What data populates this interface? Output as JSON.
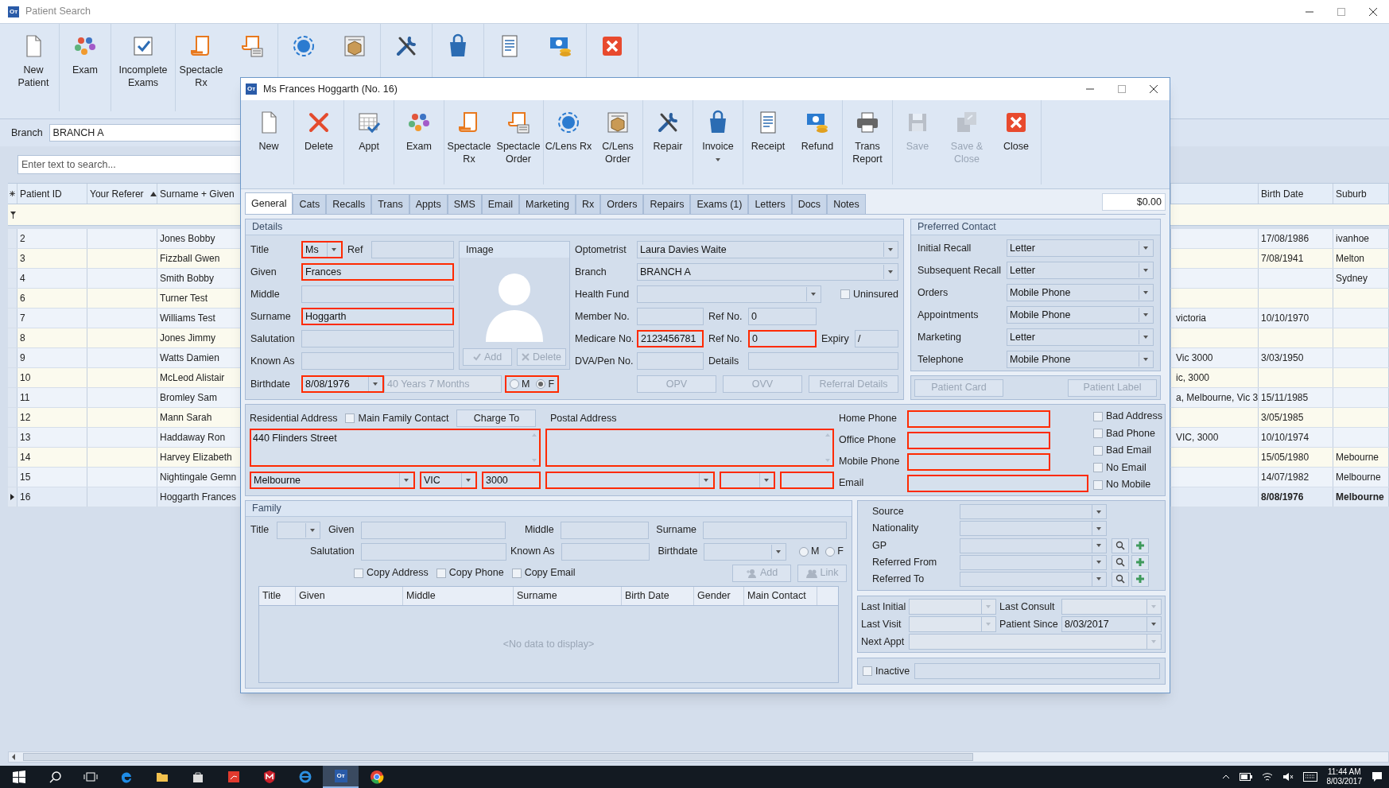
{
  "background": {
    "logo": "Oт",
    "title": "Patient Search",
    "toolbar": [
      {
        "label": "New Patient"
      },
      {
        "label": "Exam"
      },
      {
        "label": "Incomplete Exams"
      },
      {
        "label": "Spectacle Rx"
      }
    ],
    "branch": {
      "label": "Branch",
      "value": "BRANCH A"
    },
    "search": {
      "placeholder": "Enter text to search..."
    },
    "table": {
      "columns": [
        {
          "label": "Patient ID",
          "sorted": false
        },
        {
          "label": "Your Referer",
          "sorted": true
        },
        {
          "label": "Surname + Given",
          "sorted": false
        },
        {
          "label": "Birth Date",
          "sorted": false
        },
        {
          "label": "Suburb",
          "sorted": false
        }
      ],
      "rows": [
        {
          "patient_id": "2",
          "surname_given": "Jones Bobby",
          "birth_date": "17/08/1986",
          "suburb": "ivanhoe",
          "selected": false
        },
        {
          "patient_id": "3",
          "surname_given": "Fizzball Gwen",
          "birth_date": "7/08/1941",
          "suburb": "Melton",
          "selected": false
        },
        {
          "patient_id": "4",
          "surname_given": "Smith Bobby",
          "suburb": "Sydney",
          "selected": false
        },
        {
          "patient_id": "6",
          "surname_given": "Turner Test",
          "selected": false
        },
        {
          "patient_id": "7",
          "surname_given": "Williams Test",
          "address_fragment": "victoria",
          "birth_date": "10/10/1970",
          "selected": false
        },
        {
          "patient_id": "8",
          "surname_given": "Jones Jimmy",
          "selected": false
        },
        {
          "patient_id": "9",
          "surname_given": "Watts Damien",
          "address_fragment": "Vic 3000",
          "birth_date": "3/03/1950",
          "selected": false
        },
        {
          "patient_id": "10",
          "surname_given": "McLeod Alistair",
          "address_fragment": "ic, 3000",
          "selected": false
        },
        {
          "patient_id": "11",
          "surname_given": "Bromley Sam",
          "address_fragment": "a, Melbourne, Vic 3",
          "birth_date": "15/11/1985",
          "selected": false
        },
        {
          "patient_id": "12",
          "surname_given": "Mann Sarah",
          "birth_date": "3/05/1985",
          "selected": false
        },
        {
          "patient_id": "13",
          "surname_given": "Haddaway Ron",
          "address_fragment": "VIC, 3000",
          "birth_date": "10/10/1974",
          "selected": false
        },
        {
          "patient_id": "14",
          "surname_given": "Harvey Elizabeth",
          "birth_date": "15/05/1980",
          "suburb": "Mebourne",
          "selected": false
        },
        {
          "patient_id": "15",
          "surname_given": "Nightingale Gemn",
          "birth_date": "14/07/1982",
          "suburb": "Melbourne",
          "selected": false
        },
        {
          "patient_id": "16",
          "surname_given": "Hoggarth Frances",
          "birth_date": "8/08/1976",
          "suburb": "Melbourne",
          "selected": true
        }
      ]
    }
  },
  "dialog": {
    "logo": "Oт",
    "title": "Ms Frances Hoggarth (No. 16)",
    "toolbar": [
      [
        {
          "label": "New",
          "disabled": false,
          "menu": false
        }
      ],
      [
        {
          "label": "Delete",
          "disabled": false,
          "menu": false
        }
      ],
      [
        {
          "label": "Appt",
          "disabled": false,
          "menu": false
        }
      ],
      [
        {
          "label": "Exam",
          "disabled": false,
          "menu": false
        }
      ],
      [
        {
          "label": "Spectacle Rx",
          "disabled": false,
          "menu": false
        },
        {
          "label": "Spectacle Order",
          "disabled": false,
          "menu": false
        }
      ],
      [
        {
          "label": "C/Lens Rx",
          "disabled": false,
          "menu": false
        },
        {
          "label": "C/Lens Order",
          "disabled": false,
          "menu": false
        }
      ],
      [
        {
          "label": "Repair",
          "disabled": false,
          "menu": false
        }
      ],
      [
        {
          "label": "Invoice",
          "disabled": false,
          "menu": true
        }
      ],
      [
        {
          "label": "Receipt",
          "disabled": false,
          "menu": false
        },
        {
          "label": "Refund",
          "disabled": false,
          "menu": false
        }
      ],
      [
        {
          "label": "Trans Report",
          "disabled": false,
          "menu": false
        }
      ],
      [
        {
          "label": "Save",
          "disabled": true,
          "menu": false
        },
        {
          "label": "Save & Close",
          "disabled": true,
          "menu": false
        },
        {
          "label": "Close",
          "disabled": false,
          "menu": false
        }
      ]
    ],
    "tabs": [
      {
        "label": "General",
        "selected": true
      },
      {
        "label": "Cats",
        "selected": false
      },
      {
        "label": "Recalls",
        "selected": false
      },
      {
        "label": "Trans",
        "selected": false
      },
      {
        "label": "Appts",
        "selected": false
      },
      {
        "label": "SMS",
        "selected": false
      },
      {
        "label": "Email",
        "selected": false
      },
      {
        "label": "Marketing",
        "selected": false
      },
      {
        "label": "Rx",
        "selected": false
      },
      {
        "label": "Orders",
        "selected": false
      },
      {
        "label": "Repairs",
        "selected": false
      },
      {
        "label": "Exams (1)",
        "selected": false
      },
      {
        "label": "Letters",
        "selected": false
      },
      {
        "label": "Docs",
        "selected": false
      },
      {
        "label": "Notes",
        "selected": false
      }
    ],
    "balance": "$0.00",
    "details": {
      "title": "Details",
      "title_field": {
        "label": "Title",
        "kind": "combo",
        "value": "Ms",
        "highlighted": true
      },
      "ref": {
        "label": "Ref",
        "kind": "text",
        "highlighted": false
      },
      "given": {
        "label": "Given",
        "kind": "text",
        "value": "Frances",
        "highlighted": true
      },
      "middle": {
        "label": "Middle",
        "kind": "text",
        "highlighted": false
      },
      "surname": {
        "label": "Surname",
        "kind": "text",
        "value": "Hoggarth",
        "highlighted": true
      },
      "salutation": {
        "label": "Salutation",
        "kind": "text",
        "highlighted": false
      },
      "known_as": {
        "label": "Known As",
        "kind": "text",
        "highlighted": false
      },
      "birthdate": {
        "label": "Birthdate",
        "kind": "combo",
        "value": "8/08/1976",
        "highlighted": true
      },
      "age": {
        "kind": "text",
        "value": "40 Years 7 Months",
        "disabled": true
      },
      "gender": {
        "highlighted": true,
        "options": [
          {
            "label": "M",
            "selected": false
          },
          {
            "label": "F",
            "selected": true
          }
        ]
      },
      "image": {
        "title": "Image",
        "add": {
          "label": "Add",
          "disabled": true
        },
        "delete": {
          "label": "Delete",
          "disabled": true
        }
      },
      "optometrist": {
        "label": "Optometrist",
        "kind": "combo",
        "value": "Laura Davies Waite"
      },
      "branch": {
        "label": "Branch",
        "kind": "combo",
        "value": "BRANCH A"
      },
      "health_fund": {
        "label": "Health Fund",
        "kind": "combo"
      },
      "uninsured": {
        "label": "Uninsured",
        "checked": false
      },
      "member_no": {
        "label": "Member No.",
        "kind": "text",
        "highlighted": false
      },
      "member_ref": {
        "label": "Ref No.",
        "kind": "text",
        "value": "0",
        "highlighted": false
      },
      "medicare_no": {
        "label": "Medicare No.",
        "kind": "text",
        "value": "2123456781",
        "highlighted": true
      },
      "medicare_ref": {
        "label": "Ref No.",
        "kind": "text",
        "value": "0",
        "highlighted": true
      },
      "expiry": {
        "label": "Expiry",
        "kind": "text",
        "value": "/",
        "highlighted": false
      },
      "dva": {
        "label": "DVA/Pen No.",
        "kind": "text"
      },
      "dva_details": {
        "label": "Details",
        "kind": "text"
      },
      "opv": {
        "label": "OPV",
        "disabled": true
      },
      "ovv": {
        "label": "OVV",
        "disabled": true
      },
      "referral_details": {
        "label": "Referral Details",
        "disabled": true
      }
    },
    "preferred_contact": {
      "title": "Preferred Contact",
      "rows": [
        {
          "label": "Initial Recall",
          "kind": "combo",
          "value": "Letter"
        },
        {
          "label": "Subsequent Recall",
          "kind": "combo",
          "value": "Letter"
        },
        {
          "label": "Orders",
          "kind": "combo",
          "value": "Mobile Phone"
        },
        {
          "label": "Appointments",
          "kind": "combo",
          "value": "Mobile Phone"
        },
        {
          "label": "Marketing",
          "kind": "combo",
          "value": "Letter"
        },
        {
          "label": "Telephone",
          "kind": "combo",
          "value": "Mobile Phone"
        }
      ],
      "patient_card": {
        "label": "Patient Card",
        "disabled": true
      },
      "patient_label": {
        "label": "Patient Label",
        "disabled": true
      }
    },
    "address": {
      "residential_label": "Residential Address",
      "main_family_contact": {
        "label": "Main Family Contact",
        "checked": false
      },
      "charge_to": {
        "label": "Charge To",
        "disabled": false
      },
      "postal_label": "Postal Address",
      "residential": {
        "kind": "area",
        "value": "440 Flinders Street",
        "highlighted": true
      },
      "postal": {
        "kind": "area",
        "highlighted": true
      },
      "res_suburb": {
        "kind": "combo",
        "value": "Melbourne",
        "highlighted": true
      },
      "res_state": {
        "kind": "combo",
        "value": "VIC",
        "highlighted": true
      },
      "res_postcode": {
        "kind": "text",
        "value": "3000",
        "highlighted": true
      },
      "postal_suburb": {
        "kind": "combo",
        "highlighted": true
      },
      "postal_state": {
        "kind": "combo",
        "highlighted": true
      },
      "postal_postcode": {
        "kind": "text",
        "highlighted": true
      },
      "phones": [
        {
          "label": "Home Phone",
          "kind": "text",
          "highlighted": true
        },
        {
          "label": "Office Phone",
          "kind": "text",
          "highlighted": true
        },
        {
          "label": "Mobile Phone",
          "kind": "text",
          "highlighted": true
        },
        {
          "label": "Email",
          "kind": "text",
          "highlighted": true
        }
      ],
      "flags": [
        {
          "label": "Bad Address",
          "checked": false
        },
        {
          "label": "Bad Phone",
          "checked": false
        },
        {
          "label": "Bad Email",
          "checked": false
        },
        {
          "label": "No Email",
          "checked": false
        },
        {
          "label": "No Mobile",
          "checked": false
        }
      ]
    },
    "family": {
      "title": "Family",
      "title_field": {
        "label": "Title",
        "kind": "combo"
      },
      "given": {
        "label": "Given",
        "kind": "text"
      },
      "middle": {
        "label": "Middle",
        "kind": "text"
      },
      "surname": {
        "label": "Surname",
        "kind": "text"
      },
      "salutation": {
        "label": "Salutation",
        "kind": "text"
      },
      "known_as": {
        "label": "Known As",
        "kind": "text"
      },
      "birthdate": {
        "label": "Birthdate",
        "kind": "combo"
      },
      "gender": {
        "options": [
          {
            "label": "M",
            "selected": false
          },
          {
            "label": "F",
            "selected": false
          }
        ]
      },
      "copy": [
        {
          "label": "Copy Address",
          "checked": false
        },
        {
          "label": "Copy Phone",
          "checked": false
        },
        {
          "label": "Copy Email",
          "checked": false
        }
      ],
      "add": {
        "label": "Add",
        "disabled": true
      },
      "link": {
        "label": "Link",
        "disabled": true
      },
      "table": {
        "columns": [
          "Title",
          "Given",
          "Middle",
          "Surname",
          "Birth Date",
          "Gender",
          "Main Contact"
        ],
        "empty_text": "<No data to display>"
      }
    },
    "referral": {
      "rows": [
        {
          "label": "Source",
          "kind": "combo",
          "actions": false
        },
        {
          "label": "Nationality",
          "kind": "combo",
          "actions": false
        },
        {
          "label": "GP",
          "kind": "combo",
          "actions": true
        },
        {
          "label": "Referred From",
          "kind": "combo",
          "actions": true
        },
        {
          "label": "Referred To",
          "kind": "combo",
          "actions": true
        }
      ]
    },
    "visits": {
      "last_initial": {
        "label": "Last Initial",
        "kind": "combo",
        "disabled": true
      },
      "last_consult": {
        "label": "Last Consult",
        "kind": "combo",
        "disabled": true
      },
      "last_visit": {
        "label": "Last Visit",
        "kind": "combo",
        "disabled": true
      },
      "patient_since": {
        "label": "Patient Since",
        "kind": "combo",
        "value": "8/03/2017",
        "disabled": false
      },
      "next_appt": {
        "label": "Next Appt",
        "kind": "combo",
        "disabled": true
      }
    },
    "inactive": {
      "label": "Inactive",
      "checked": false
    }
  },
  "taskbar": {
    "apps": [
      {
        "selected": false
      },
      {
        "selected": false
      },
      {
        "selected": false
      },
      {
        "selected": false
      },
      {
        "selected": false
      },
      {
        "selected": false
      },
      {
        "logo": "Oт",
        "selected": true
      },
      {
        "selected": false
      }
    ],
    "time": "11:44 AM",
    "date": "8/03/2017"
  }
}
